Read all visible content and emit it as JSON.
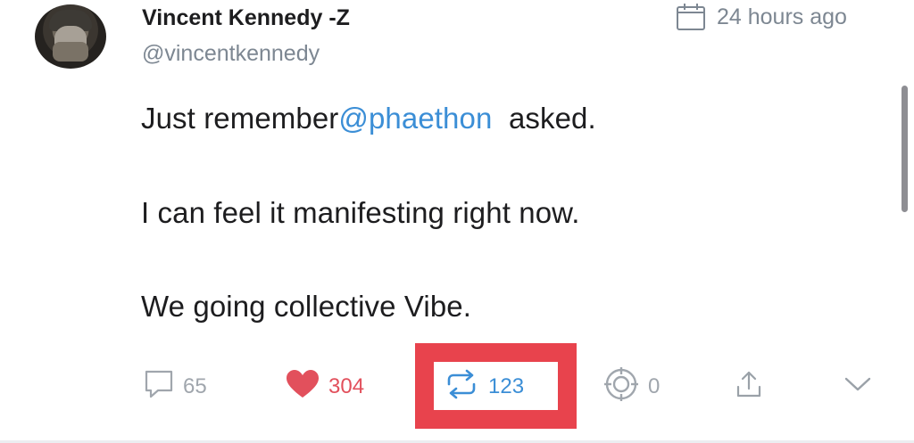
{
  "post": {
    "author_name": "Vincent Kennedy -Z",
    "author_handle": "@vincentkennedy",
    "timestamp": "24 hours ago",
    "text": {
      "line1_prefix": "Just remember",
      "line1_mention": "@phaethon",
      "line1_suffix": "  asked.",
      "line2": "I can feel it manifesting right now.",
      "line3": "We going collective Vibe."
    }
  },
  "actions": {
    "replies": "65",
    "likes": "304",
    "reposts": "123",
    "bookmarks": "0"
  },
  "colors": {
    "mention": "#3b8ed6",
    "like": "#e2505c",
    "repost": "#3b8ed6",
    "muted": "#a0a6ad",
    "highlight": "#e8434d"
  },
  "icons": {
    "timestamp": "calendar-icon",
    "reply": "reply-icon",
    "like": "heart-icon",
    "repost": "repost-icon",
    "bookmark": "target-icon",
    "share": "share-icon",
    "more": "chevron-down-icon"
  }
}
